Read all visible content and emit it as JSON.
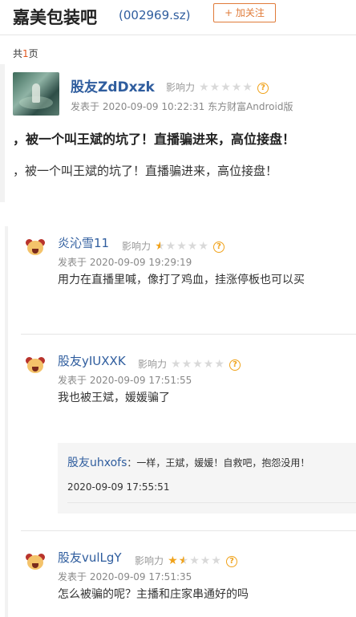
{
  "header": {
    "bar_name": "嘉美包装吧",
    "stock_code": "(002969.sz)",
    "follow_label": "+ 加关注"
  },
  "pagination": {
    "prefix": "共",
    "count": "1",
    "suffix": "页"
  },
  "post": {
    "author": "股友ZdDxzk",
    "impact_label": "影响力",
    "impact_stars": 0,
    "meta": "发表于 2020-09-09 10:22:31 东方财富Android版",
    "title": "，被一个叫王斌的坑了！直播骗进来，高位接盘！",
    "body": "，被一个叫王斌的坑了！直播骗进来，高位接盘！"
  },
  "replies": [
    {
      "author": "炎沁雪11",
      "impact_label": "影响力",
      "impact_stars": 0.5,
      "meta": "发表于 2020-09-09 19:29:19",
      "text": "用力在直播里喊，像打了鸡血，挂涨停板也可以买"
    },
    {
      "author": "股友yIUXXK",
      "impact_label": "影响力",
      "impact_stars": 0,
      "meta": "发表于 2020-09-09 17:51:55",
      "text": "我也被王斌，媛媛骗了",
      "quote": {
        "author": "股友uhxofs",
        "text": "：一样，王斌，媛媛！自救吧，抱怨没用！",
        "time": "2020-09-09 17:55:51"
      }
    },
    {
      "author": "股友vulLgY",
      "impact_label": "影响力",
      "impact_stars": 1.5,
      "meta": "发表于 2020-09-09 17:51:35",
      "text": "怎么被骗的呢？主播和庄家串通好的吗"
    }
  ],
  "icons": {
    "help": "question-circle-icon",
    "avatar": "cartoon-avatar-icon"
  },
  "colors": {
    "link_blue": "#2f5d9e",
    "star_gold": "#f0a21a",
    "follow_orange": "#e07b39"
  }
}
